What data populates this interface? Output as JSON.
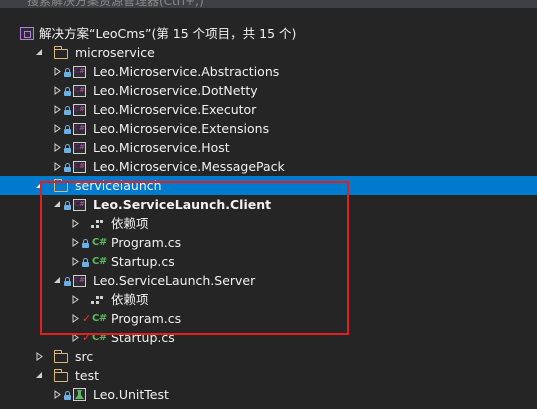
{
  "search": {
    "placeholder": "搜索解决方案资源管理器(Ctrl+;)"
  },
  "solution": {
    "label": "解决方案“LeoCms”(第 15 个项目，共 15 个)"
  },
  "tree": {
    "microservice": {
      "label": "microservice",
      "projects": [
        "Leo.Microservice.Abstractions",
        "Leo.Microservice.DotNetty",
        "Leo.Microservice.Executor",
        "Leo.Microservice.Extensions",
        "Leo.Microservice.Host",
        "Leo.Microservice.MessagePack"
      ]
    },
    "servicelaunch": {
      "label": "servicelaunch",
      "client": {
        "label": "Leo.ServiceLaunch.Client",
        "deps": "依赖项",
        "file1": "Program.cs",
        "file2": "Startup.cs"
      },
      "server": {
        "label": "Leo.ServiceLaunch.Server",
        "deps": "依赖项",
        "file1": "Program.cs",
        "file2": "Startup.cs"
      }
    },
    "src": {
      "label": "src"
    },
    "test": {
      "label": "test",
      "project": "Leo.UnitTest"
    }
  },
  "colors": {
    "background": "#252526",
    "selection": "#007acc",
    "highlight_box": "#e02020",
    "folder": "#dcb67a",
    "csharp": "#5cb85c",
    "modified_check": "#d83b3b"
  }
}
